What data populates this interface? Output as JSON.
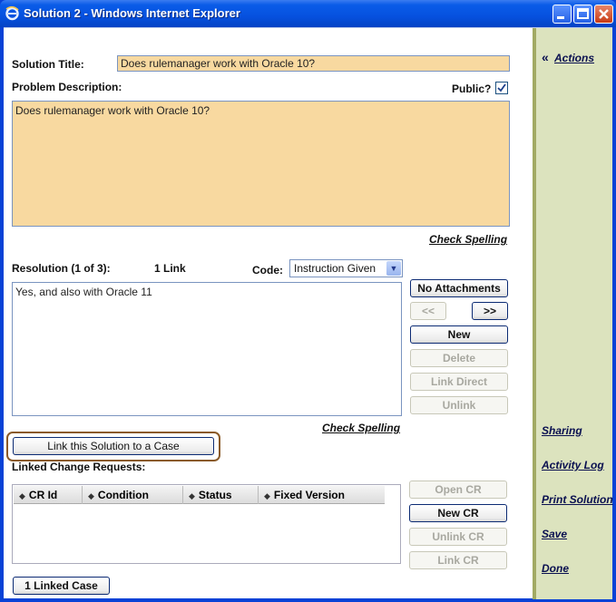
{
  "window": {
    "title": "Solution 2 - Windows Internet Explorer",
    "title_color": "#0842d6"
  },
  "form": {
    "solution_title_label": "Solution Title:",
    "solution_title_value": "Does rulemanager work with Oracle 10?",
    "problem_description_label": "Problem Description:",
    "public_label": "Public?",
    "public_checked": true,
    "problem_description_value": "Does rulemanager work with Oracle 10?",
    "check_spelling_1": "Check Spelling",
    "resolution_label": "Resolution (1 of 3):",
    "link_count": "1 Link",
    "code_label": "Code:",
    "code_value": "Instruction Given",
    "resolution_value": "Yes, and also with Oracle 11",
    "check_spelling_2": "Check Spelling",
    "link_solution_button": "Link this Solution to a Case",
    "linked_change_requests_label": "Linked Change Requests:",
    "linked_case_button": "1 Linked Case"
  },
  "resolution_buttons": {
    "attachments": "No Attachments",
    "prev": "<<",
    "next": ">>",
    "new": "New",
    "delete": "Delete",
    "link_direct": "Link Direct",
    "unlink": "Unlink"
  },
  "cr_table": {
    "columns": [
      "CR Id",
      "Condition",
      "Status",
      "Fixed Version"
    ],
    "rows": []
  },
  "cr_buttons": {
    "open_cr": "Open CR",
    "new_cr": "New CR",
    "unlink_cr": "Unlink CR",
    "link_cr": "Link CR"
  },
  "side_panel": {
    "collapse_glyph": "«",
    "actions": "Actions",
    "sharing": "Sharing",
    "activity_log": "Activity Log",
    "print_solution": "Print Solution",
    "save": "Save",
    "done": "Done",
    "background_color": "#dce3be"
  },
  "colors": {
    "field_tan": "#f8d9a0",
    "highlight_outline": "#8a5a28"
  }
}
